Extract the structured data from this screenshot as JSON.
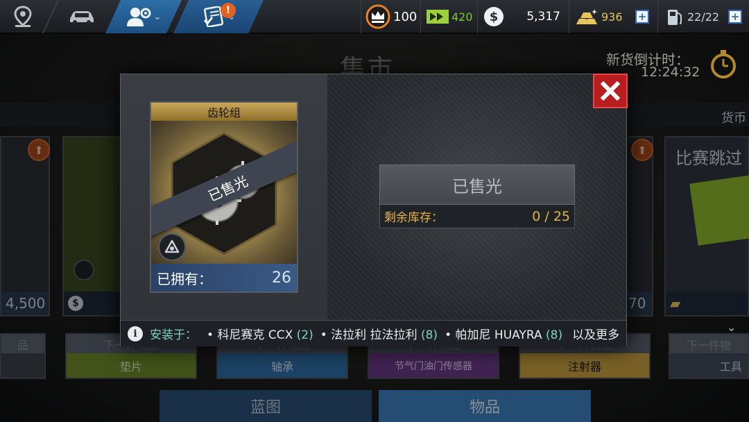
{
  "topbar": {
    "tabs": [
      {
        "id": "map",
        "icon": "map-pin-icon"
      },
      {
        "id": "garage",
        "icon": "car-icon"
      },
      {
        "id": "team",
        "icon": "team-settings-icon"
      },
      {
        "id": "tasks",
        "icon": "tasks-icon"
      }
    ],
    "alert_badge": "!",
    "resources": {
      "crowns": "100",
      "skips": "420",
      "cash": "5,317",
      "gold": "936",
      "fuel": "22/22"
    }
  },
  "background": {
    "title": "集市",
    "timer_label": "新货倒计时：",
    "timer_value": "12:24:32",
    "currency_label": "货币",
    "card_prices": [
      "4,500",
      "70"
    ],
    "race_skip_title": "比赛跳过",
    "next_item_label": "下一件物品",
    "next_items": [
      {
        "top": "品",
        "bottom": ""
      },
      {
        "top": "下一件物品",
        "bottom": "垫片"
      },
      {
        "top": "下一件物品",
        "bottom": "轴承"
      },
      {
        "top": "下一件物品",
        "bottom": "节气门油门传感器"
      },
      {
        "top": "下一件物品",
        "bottom": "注射器"
      },
      {
        "top": "下一件物",
        "bottom": "工具"
      }
    ],
    "bottom_tabs": [
      "蓝图",
      "物品"
    ]
  },
  "modal": {
    "item_name": "齿轮组",
    "sold_ribbon": "已售光",
    "owned_label": "已拥有：",
    "owned_value": "26",
    "status_label": "已售光",
    "stock_label": "剩余库存：",
    "stock_value": "0 / 25",
    "installed_label": "安装于：",
    "installed_cars": [
      {
        "name": "• 科尼赛克 CCX",
        "count": "(2)"
      },
      {
        "name": "• 法拉利 拉法拉利",
        "count": "(8)"
      },
      {
        "name": "• 帕加尼 HUAYRA",
        "count": "(8)"
      }
    ],
    "more_label": "以及更多"
  }
}
